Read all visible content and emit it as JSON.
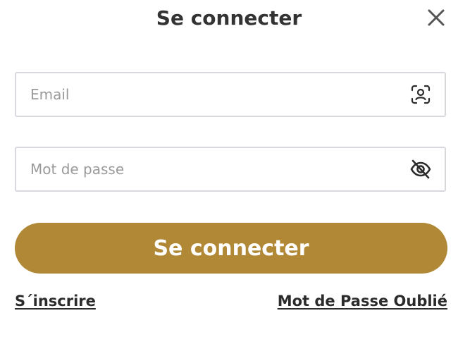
{
  "dialog": {
    "title": "Se connecter"
  },
  "close": {
    "icon": "close-icon"
  },
  "email": {
    "placeholder": "Email",
    "value": "",
    "icon": "face-id-icon"
  },
  "password": {
    "placeholder": "Mot de passe",
    "value": "",
    "icon": "eye-off-icon"
  },
  "submit": {
    "label": "Se connecter"
  },
  "links": {
    "signup": "S´inscrire",
    "forgot": "Mot de Passe Oublié"
  },
  "colors": {
    "accent": "#b08836",
    "border": "#d7d9de",
    "text": "#333333"
  }
}
